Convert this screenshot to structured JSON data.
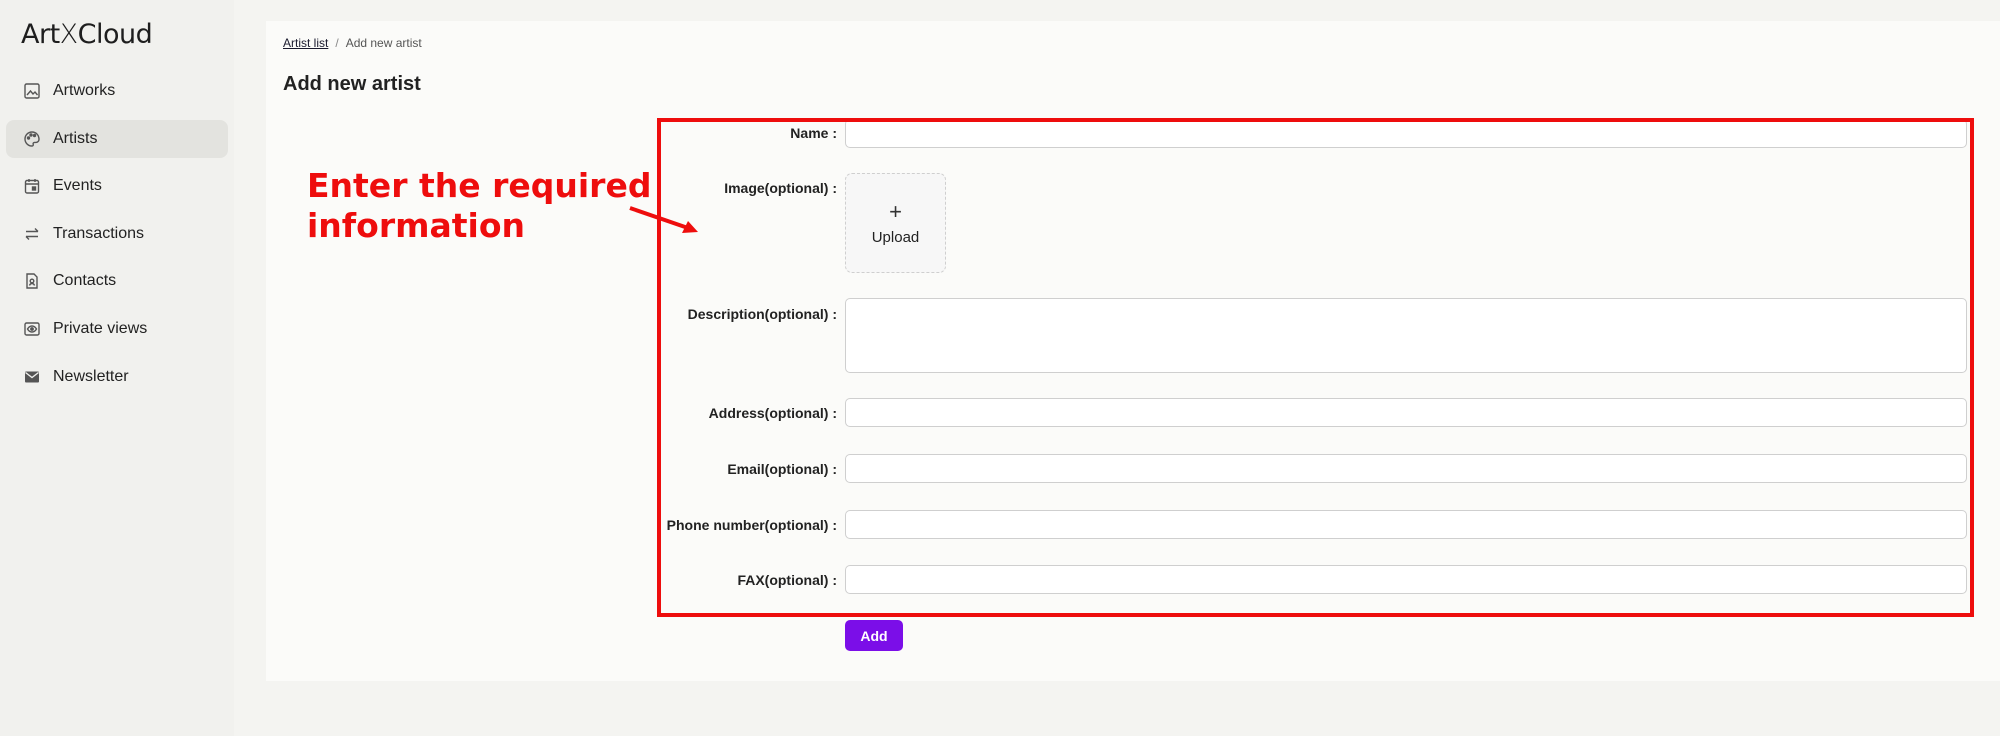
{
  "app": {
    "logo_left": "Art",
    "logo_x": "X",
    "logo_right": "Cloud"
  },
  "sidebar": {
    "items": [
      {
        "label": "Artworks",
        "icon": "image-icon",
        "active": false
      },
      {
        "label": "Artists",
        "icon": "palette-icon",
        "active": true
      },
      {
        "label": "Events",
        "icon": "calendar-icon",
        "active": false
      },
      {
        "label": "Transactions",
        "icon": "swap-arrows-icon",
        "active": false
      },
      {
        "label": "Contacts",
        "icon": "contact-file-icon",
        "active": false
      },
      {
        "label": "Private views",
        "icon": "eye-frame-icon",
        "active": false
      },
      {
        "label": "Newsletter",
        "icon": "mail-icon",
        "active": false
      }
    ]
  },
  "breadcrumb": {
    "link": "Artist list",
    "separator": "/",
    "current": "Add new artist"
  },
  "page": {
    "title": "Add new artist"
  },
  "form": {
    "name_label": "Name",
    "image_label": "Image(optional)",
    "upload_plus": "+",
    "upload_label": "Upload",
    "description_label": "Description(optional)",
    "address_label": "Address(optional)",
    "email_label": "Email(optional)",
    "phone_label": "Phone number(optional)",
    "fax_label": "FAX(optional)",
    "colon": ":",
    "name_value": "",
    "description_value": "",
    "address_value": "",
    "email_value": "",
    "phone_value": "",
    "fax_value": ""
  },
  "actions": {
    "add_label": "Add"
  },
  "annotation": {
    "line1": "Enter the required",
    "line2": "information"
  },
  "colors": {
    "accent": "#7b0ee8",
    "annotation": "#ee0d0d",
    "sidebar_active": "#e3e3df"
  }
}
